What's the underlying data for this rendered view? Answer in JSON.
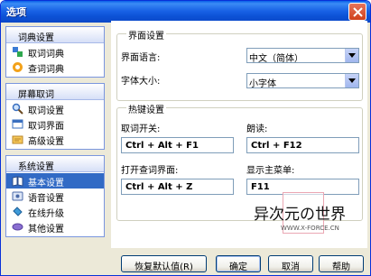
{
  "window": {
    "title": "选项"
  },
  "sidebar": {
    "groups": [
      {
        "header": "词典设置",
        "items": [
          {
            "label": "取词词典",
            "icon": "dictionary-icon"
          },
          {
            "label": "查词词典",
            "icon": "lookup-dictionary-icon"
          }
        ]
      },
      {
        "header": "屏幕取词",
        "items": [
          {
            "label": "取词设置",
            "icon": "magnifier-icon"
          },
          {
            "label": "取词界面",
            "icon": "window-icon"
          },
          {
            "label": "高级设置",
            "icon": "pencil-icon"
          }
        ]
      },
      {
        "header": "系统设置",
        "items": [
          {
            "label": "基本设置",
            "icon": "book-icon",
            "selected": true
          },
          {
            "label": "语音设置",
            "icon": "speaker-icon"
          },
          {
            "label": "在线升级",
            "icon": "globe-icon"
          },
          {
            "label": "其他设置",
            "icon": "pill-icon"
          }
        ]
      }
    ]
  },
  "interface": {
    "legend": "界面设置",
    "language_label": "界面语言:",
    "language_value": "中文（简体）",
    "fontsize_label": "字体大小:",
    "fontsize_value": "小字体"
  },
  "hotkeys": {
    "legend": "热键设置",
    "capture_label": "取词开关:",
    "capture_value": "Ctrl + Alt + F1",
    "read_label": "朗读:",
    "read_value": "Ctrl + F12",
    "lookup_label": "打开查词界面:",
    "lookup_value": "Ctrl + Alt + Z",
    "menu_label": "显示主菜单:",
    "menu_value": "F11"
  },
  "watermark": {
    "text": "异次元の世界",
    "sub": "WWW.X-FORCE.CN"
  },
  "buttons": {
    "restore": "恢复默认值(R)",
    "ok": "确定",
    "cancel": "取消",
    "help": "帮助"
  },
  "colors": {
    "titlebar": "#0c52d6",
    "selected": "#316ac5",
    "face": "#ece9d8"
  }
}
